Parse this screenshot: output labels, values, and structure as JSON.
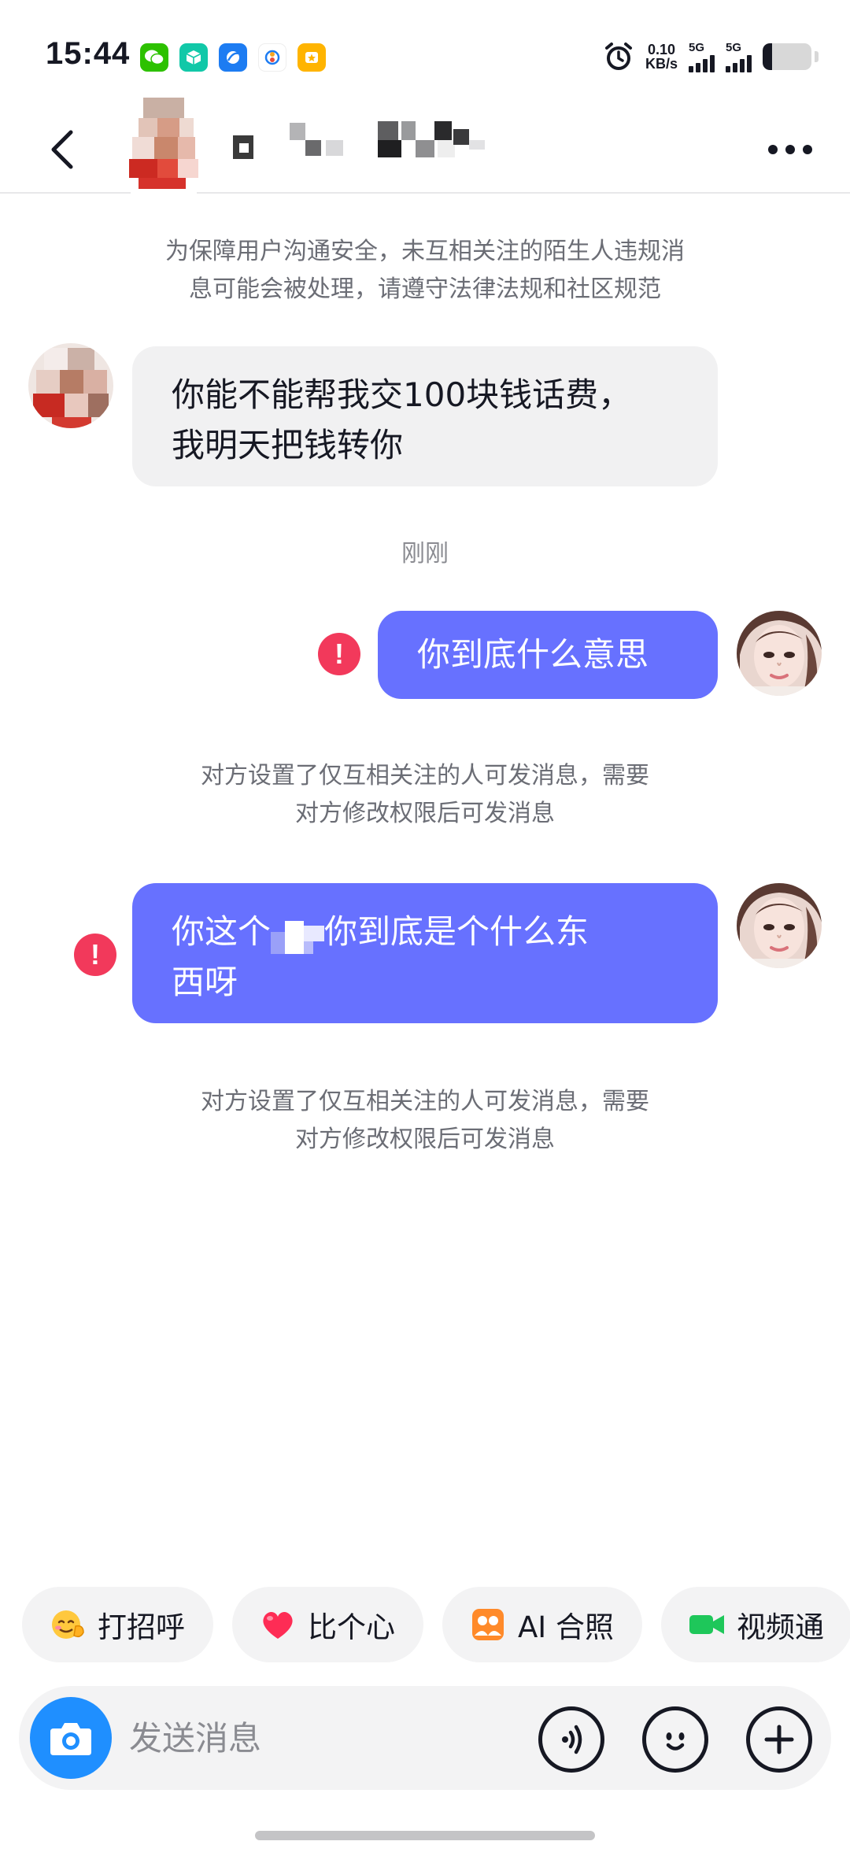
{
  "status_bar": {
    "time": "15:44",
    "net_speed_value": "0.10",
    "net_speed_unit": "KB/s",
    "sim1_label": "5G",
    "sim2_label": "5G",
    "battery_level": 0.2
  },
  "header": {
    "name_obscured": true
  },
  "chat": {
    "safety_notice_line1": "为保障用户沟通安全，未互相关注的陌生人违规消",
    "safety_notice_line2": "息可能会被处理，请遵守法律法规和社区规范",
    "msg1_line1": "你能不能帮我交100块钱话费，",
    "msg1_line2": "我明天把钱转你",
    "time_label": "刚刚",
    "msg2": "你到底什么意思",
    "error_mark": "!",
    "restrict_notice_line1": "对方设置了仅互相关注的人可发消息，需要",
    "restrict_notice_line2": "对方修改权限后可发消息",
    "msg3_part1": "你这个",
    "msg3_part2": "你到底是个什么东",
    "msg3_line2": "西呀"
  },
  "quick_replies": [
    {
      "label": "打招呼",
      "icon": "wave-emoji-icon"
    },
    {
      "label": "比个心",
      "icon": "heart-icon"
    },
    {
      "label": "AI 合照",
      "icon": "ai-photo-icon"
    },
    {
      "label": "视频通",
      "icon": "video-call-icon"
    }
  ],
  "input": {
    "placeholder": "发送消息"
  },
  "colors": {
    "outgoing_bubble": "#6771ff",
    "incoming_bubble": "#f1f1f2",
    "error": "#f2395b",
    "camera": "#1f8fff"
  }
}
